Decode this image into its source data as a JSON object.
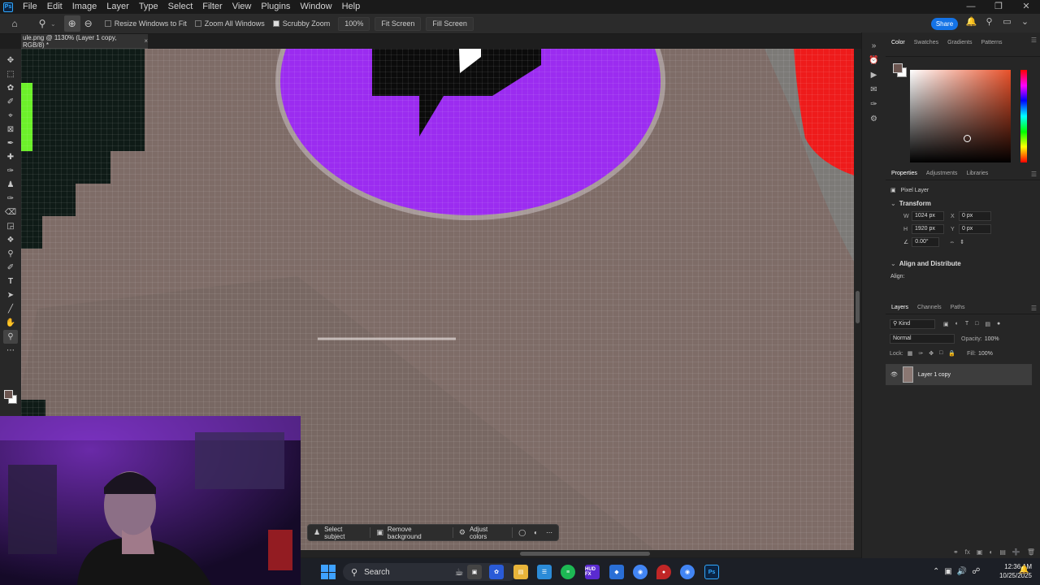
{
  "app": {
    "logo_text": "Ps",
    "menu": [
      "File",
      "Edit",
      "Image",
      "Layer",
      "Type",
      "Select",
      "Filter",
      "View",
      "Plugins",
      "Window",
      "Help"
    ],
    "window_controls": [
      "minimize-icon",
      "restore-icon",
      "close-icon"
    ]
  },
  "options_bar": {
    "resize_windows_to_fit": "Resize Windows to Fit",
    "resize_checked": false,
    "zoom_all_windows": "Zoom All Windows",
    "zoom_all_checked": false,
    "scrubby_zoom": "Scrubby Zoom",
    "scrubby_checked": true,
    "zoom_value": "100%",
    "fit_screen": "Fit Screen",
    "fill_screen": "Fill Screen",
    "share": "Share"
  },
  "document": {
    "tab_title": "ule.png @ 1130% (Layer 1 copy, RGB/8) *",
    "close": "×"
  },
  "context_bar": {
    "select_subject": "Select subject",
    "remove_background": "Remove background",
    "adjust_colors": "Adjust colors"
  },
  "color_panel": {
    "tabs": [
      "Color",
      "Swatches",
      "Gradients",
      "Patterns"
    ],
    "active_tab": "Color",
    "foreground": "#6b5550",
    "background": "#ffffff"
  },
  "properties_panel": {
    "tabs": [
      "Properties",
      "Adjustments",
      "Libraries"
    ],
    "active_tab": "Properties",
    "layer_type": "Pixel Layer",
    "transform_header": "Transform",
    "w_label": "W",
    "w_value": "1024 px",
    "h_label": "H",
    "h_value": "1920 px",
    "x_label": "X",
    "x_value": "0 px",
    "y_label": "Y",
    "y_value": "0 px",
    "angle_value": "0.00°",
    "align_header": "Align and Distribute",
    "align_label": "Align:"
  },
  "layers_panel": {
    "tabs": [
      "Layers",
      "Channels",
      "Paths"
    ],
    "active_tab": "Layers",
    "filter_kind": "Kind",
    "blend_mode": "Normal",
    "opacity_label": "Opacity:",
    "opacity_value": "100%",
    "lock_label": "Lock:",
    "fill_label": "Fill:",
    "fill_value": "100%",
    "layers": [
      {
        "name": "Layer 1 copy",
        "visible": true,
        "selected": true
      }
    ]
  },
  "taskbar": {
    "search_text": "Search",
    "apps": [
      "file-explorer-icon",
      "spotify-icon",
      "hudfx-icon",
      "chrome-icon",
      "photoshop-icon"
    ],
    "hudfx_label": "HUD FX",
    "time": "12:36 AM",
    "date": "10/25/2025"
  }
}
